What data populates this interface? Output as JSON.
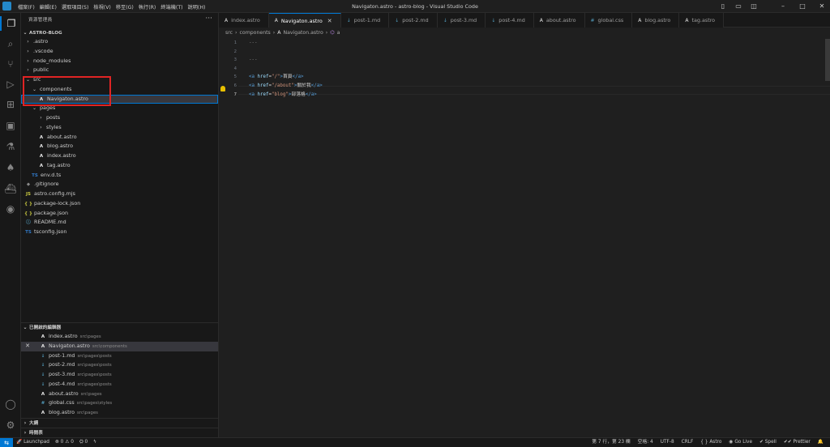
{
  "titlebar": {
    "menu": [
      "檔案(F)",
      "編輯(E)",
      "選取項目(S)",
      "檢視(V)",
      "移至(G)",
      "執行(R)",
      "終端機(T)",
      "說明(H)"
    ],
    "window_title": "Navigaton.astro - astro-blog - Visual Studio Code"
  },
  "sidebar": {
    "title": "資源管理員",
    "more_icon": "ellipsis-icon",
    "project": "ASTRO-BLOG",
    "tree": [
      {
        "label": ".astro",
        "depth": 1,
        "type": "folder",
        "expanded": false
      },
      {
        "label": ".vscode",
        "depth": 1,
        "type": "folder",
        "expanded": false
      },
      {
        "label": "node_modules",
        "depth": 1,
        "type": "folder",
        "expanded": false
      },
      {
        "label": "public",
        "depth": 1,
        "type": "folder",
        "expanded": false
      },
      {
        "label": "src",
        "depth": 1,
        "type": "folder",
        "expanded": true
      },
      {
        "label": "components",
        "depth": 2,
        "type": "folder",
        "expanded": true
      },
      {
        "label": "Navigaton.astro",
        "depth": 3,
        "type": "astro",
        "selected": true
      },
      {
        "label": "pages",
        "depth": 2,
        "type": "folder",
        "expanded": true
      },
      {
        "label": "posts",
        "depth": 3,
        "type": "folder",
        "expanded": false
      },
      {
        "label": "styles",
        "depth": 3,
        "type": "folder",
        "expanded": false
      },
      {
        "label": "about.astro",
        "depth": 3,
        "type": "astro"
      },
      {
        "label": "blog.astro",
        "depth": 3,
        "type": "astro"
      },
      {
        "label": "index.astro",
        "depth": 3,
        "type": "astro"
      },
      {
        "label": "tag.astro",
        "depth": 3,
        "type": "astro"
      },
      {
        "label": "env.d.ts",
        "depth": 2,
        "type": "ts"
      },
      {
        "label": ".gitignore",
        "depth": 1,
        "type": "git"
      },
      {
        "label": "astro.config.mjs",
        "depth": 1,
        "type": "js"
      },
      {
        "label": "package-lock.json",
        "depth": 1,
        "type": "json"
      },
      {
        "label": "package.json",
        "depth": 1,
        "type": "json"
      },
      {
        "label": "README.md",
        "depth": 1,
        "type": "info"
      },
      {
        "label": "tsconfig.json",
        "depth": 1,
        "type": "ts"
      }
    ],
    "open_editors_title": "已開啟的編輯器",
    "open_editors": [
      {
        "name": "index.astro",
        "path": "src\\pages",
        "type": "astro"
      },
      {
        "name": "Navigaton.astro",
        "path": "src\\components",
        "type": "astro",
        "active": true
      },
      {
        "name": "post-1.md",
        "path": "src\\pages\\posts",
        "type": "md"
      },
      {
        "name": "post-2.md",
        "path": "src\\pages\\posts",
        "type": "md"
      },
      {
        "name": "post-3.md",
        "path": "src\\pages\\posts",
        "type": "md"
      },
      {
        "name": "post-4.md",
        "path": "src\\pages\\posts",
        "type": "md"
      },
      {
        "name": "about.astro",
        "path": "src\\pages",
        "type": "astro"
      },
      {
        "name": "global.css",
        "path": "src\\pages\\styles",
        "type": "css"
      },
      {
        "name": "blog.astro",
        "path": "src\\pages",
        "type": "astro"
      }
    ],
    "outline_title": "大綱",
    "timeline_title": "時間表"
  },
  "tabs": [
    {
      "label": "index.astro",
      "type": "astro"
    },
    {
      "label": "Navigaton.astro",
      "type": "astro",
      "active": true
    },
    {
      "label": "post-1.md",
      "type": "md"
    },
    {
      "label": "post-2.md",
      "type": "md"
    },
    {
      "label": "post-3.md",
      "type": "md"
    },
    {
      "label": "post-4.md",
      "type": "md"
    },
    {
      "label": "about.astro",
      "type": "astro"
    },
    {
      "label": "global.css",
      "type": "css"
    },
    {
      "label": "blog.astro",
      "type": "astro"
    },
    {
      "label": "tag.astro",
      "type": "astro"
    }
  ],
  "breadcrumb": [
    "src",
    "components",
    "Navigaton.astro",
    "a"
  ],
  "editor": {
    "current_line": 7,
    "lines": [
      [
        {
          "t": "---",
          "c": "cmt"
        }
      ],
      [],
      [
        {
          "t": "---",
          "c": "cmt"
        }
      ],
      [],
      [
        {
          "t": "<a ",
          "c": "tag"
        },
        {
          "t": "href",
          "c": "attr"
        },
        {
          "t": "=",
          "c": "txt"
        },
        {
          "t": "\"/\"",
          "c": "str"
        },
        {
          "t": ">",
          "c": "tag"
        },
        {
          "t": "首頁",
          "c": "txt"
        },
        {
          "t": "</a>",
          "c": "tag"
        }
      ],
      [
        {
          "t": "<a ",
          "c": "tag"
        },
        {
          "t": "href",
          "c": "attr"
        },
        {
          "t": "=",
          "c": "txt"
        },
        {
          "t": "\"/about\"",
          "c": "str"
        },
        {
          "t": ">",
          "c": "tag"
        },
        {
          "t": "關於我",
          "c": "txt"
        },
        {
          "t": "</a>",
          "c": "tag"
        }
      ],
      [
        {
          "t": "<a ",
          "c": "tag"
        },
        {
          "t": "href",
          "c": "attr"
        },
        {
          "t": "=",
          "c": "txt"
        },
        {
          "t": "\"blog\"",
          "c": "str"
        },
        {
          "t": ">",
          "c": "tag"
        },
        {
          "t": "部落格",
          "c": "txt"
        },
        {
          "t": "</a>",
          "c": "tag"
        }
      ]
    ]
  },
  "statusbar": {
    "launchpad": "Launchpad",
    "errors": "0",
    "warnings": "0",
    "ports": "0",
    "position": "第 7 行，第 23 欄",
    "spaces": "空格: 4",
    "encoding": "UTF-8",
    "eol": "CRLF",
    "language": "Astro",
    "golive": "Go Live",
    "spell": "Spell",
    "prettier": "Prettier"
  },
  "colors": {
    "accent": "#0078d4",
    "highlight_box": "#e02424"
  }
}
